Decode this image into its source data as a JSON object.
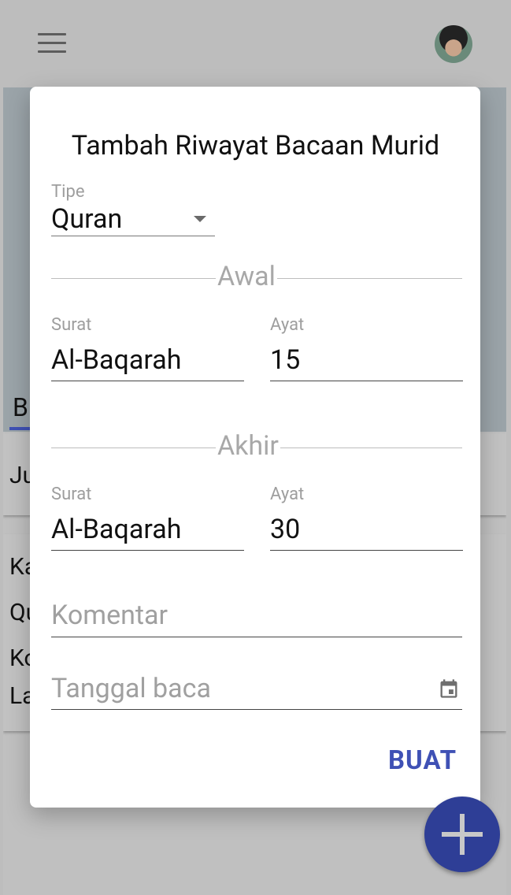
{
  "background": {
    "tab_fragment": "B",
    "card1_text": "Ju",
    "card2_lines": [
      "Ka",
      "Qu",
      "Ko",
      "La"
    ]
  },
  "dialog": {
    "title": "Tambah Riwayat Bacaan Murid",
    "type_label": "Tipe",
    "type_value": "Quran",
    "start": {
      "section": "Awal",
      "surah_label": "Surat",
      "surah_value": "Al-Baqarah",
      "ayah_label": "Ayat",
      "ayah_value": "15"
    },
    "end": {
      "section": "Akhir",
      "surah_label": "Surat",
      "surah_value": "Al-Baqarah",
      "ayah_label": "Ayat",
      "ayah_value": "30"
    },
    "comment_placeholder": "Komentar",
    "date_placeholder": "Tanggal baca",
    "submit_label": "BUAT"
  },
  "colors": {
    "accent": "#3f51b5",
    "fab": "#2e3e96"
  },
  "icons": {
    "menu": "menu-icon",
    "avatar": "avatar",
    "dropdown": "arrow-drop-down-icon",
    "calendar": "calendar-icon",
    "fab": "plus-icon"
  }
}
